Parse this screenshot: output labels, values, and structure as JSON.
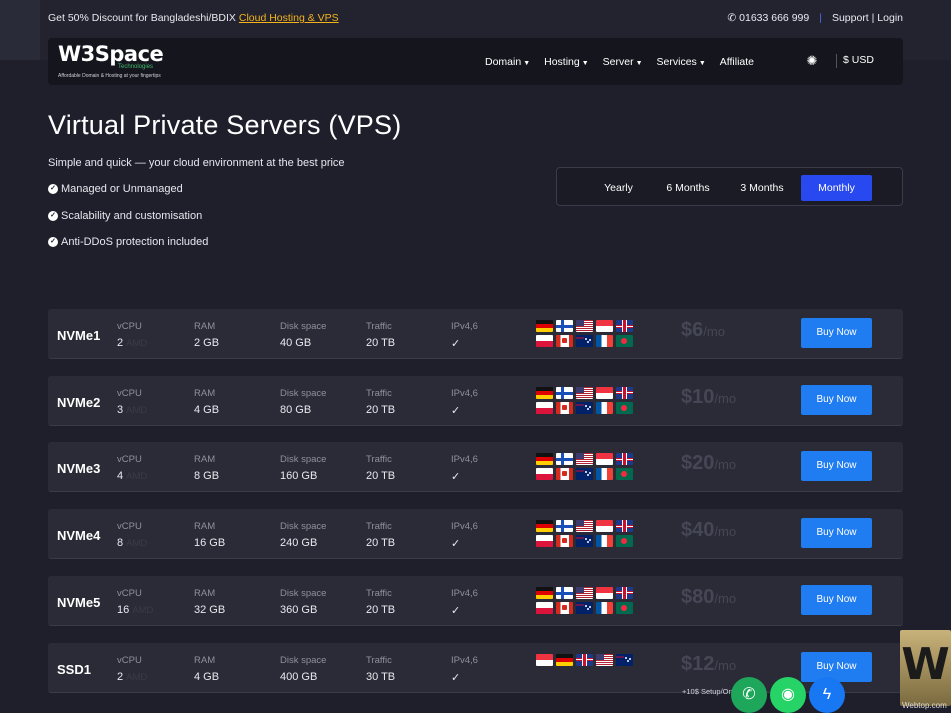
{
  "topbar": {
    "promo_text": "Get 50% Discount for Bangladeshi/BDIX",
    "promo_link": "Cloud Hosting & VPS",
    "phone": "01633 666 999",
    "support": "Support",
    "login": "Login",
    "divider": "|"
  },
  "brand": {
    "name": "W3Space",
    "sub": "Technologies",
    "tagline": "Affordable Domain & Hosting at your fingertips"
  },
  "nav": {
    "items": [
      "Domain",
      "Hosting",
      "Server",
      "Services",
      "Affiliate"
    ],
    "currency": "$ USD"
  },
  "hero": {
    "title": "Virtual Private Servers (VPS)",
    "lead": "Simple and quick — your cloud environment at the best price",
    "features": [
      "Managed or Unmanaged",
      "Scalability and customisation",
      "Anti-DDoS protection included"
    ]
  },
  "period": {
    "options": [
      "Yearly",
      "6 Months",
      "3 Months",
      "Monthly"
    ],
    "selected": "Monthly"
  },
  "labels": {
    "vcpu": "vCPU",
    "ram": "RAM",
    "disk": "Disk space",
    "traffic": "Traffic",
    "ipv": "IPv4,6",
    "ipv_value": "✓",
    "buy": "Buy Now",
    "cpu_brand": "AMD",
    "per_month": "/mo"
  },
  "plans": [
    {
      "name": "NVMe1",
      "vcpu": "2",
      "ram": "2 GB",
      "disk": "40 GB",
      "traffic": "20 TB",
      "price": "$6"
    },
    {
      "name": "NVMe2",
      "vcpu": "3",
      "ram": "4 GB",
      "disk": "80 GB",
      "traffic": "20 TB",
      "price": "$10"
    },
    {
      "name": "NVMe3",
      "vcpu": "4",
      "ram": "8 GB",
      "disk": "160 GB",
      "traffic": "20 TB",
      "price": "$20"
    },
    {
      "name": "NVMe4",
      "vcpu": "8",
      "ram": "16 GB",
      "disk": "240 GB",
      "traffic": "20 TB",
      "price": "$40"
    },
    {
      "name": "NVMe5",
      "vcpu": "16",
      "ram": "32 GB",
      "disk": "360 GB",
      "traffic": "20 TB",
      "price": "$80"
    },
    {
      "name": "SSD1",
      "vcpu": "2",
      "ram": "4 GB",
      "disk": "400 GB",
      "traffic": "30 TB",
      "price": "$12",
      "setup": "+10$ Setup/One"
    }
  ],
  "flags_nvme": [
    "germany-flag",
    "finland-flag",
    "usa-flag",
    "singapore-flag",
    "uk-flag",
    "poland-flag",
    "canada-flag",
    "australia-flag",
    "france-flag",
    "bangladesh-flag"
  ],
  "flags_ssd": [
    "singapore-flag",
    "germany-flag",
    "uk-flag",
    "usa-flag",
    "australia-flag"
  ],
  "colors": {
    "accent": "#2848f0",
    "buy": "#1f7cf1",
    "promo_link": "#f3b41b",
    "phone_fab": "#1ea65a",
    "whatsapp_fab": "#25d366",
    "messenger_fab": "#1877f2"
  },
  "watermark": {
    "logo": "W",
    "text": "Webtop.com"
  }
}
